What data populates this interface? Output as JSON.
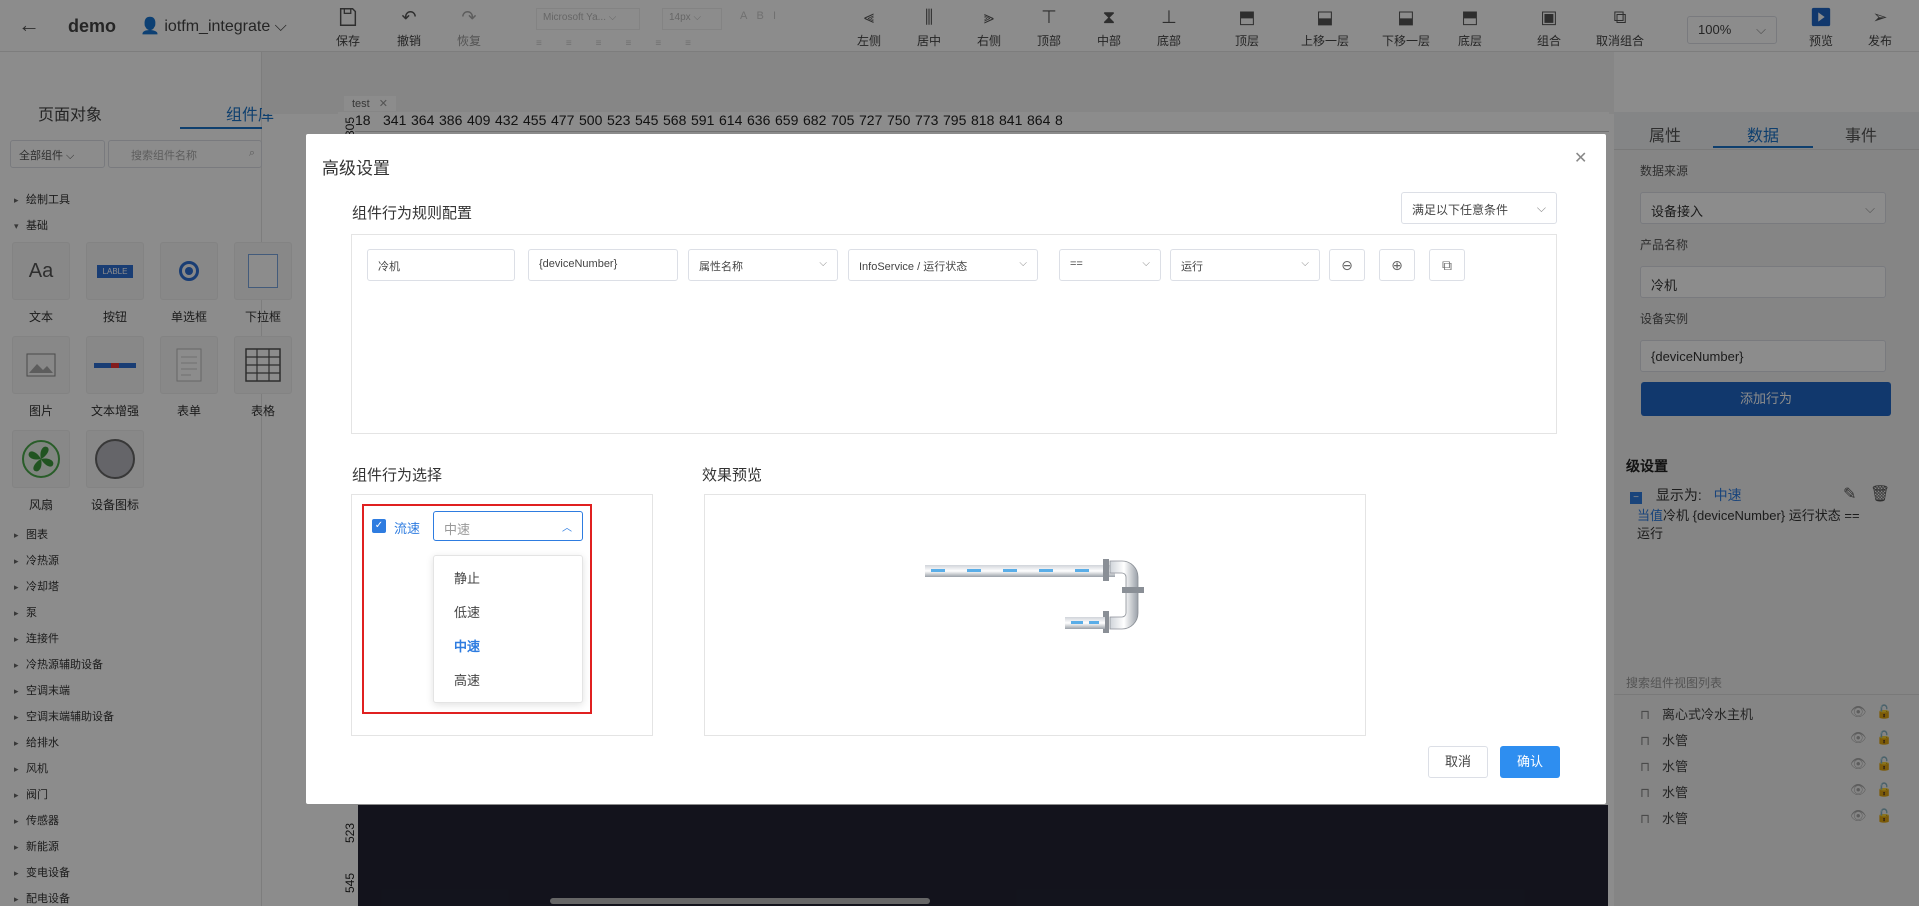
{
  "header": {
    "project": "demo",
    "user": "iotfm_integrate",
    "tools": [
      {
        "label": "保存",
        "icon": "save-icon"
      },
      {
        "label": "撤销",
        "icon": "undo-icon"
      },
      {
        "label": "恢复",
        "icon": "redo-icon"
      }
    ],
    "font_family": "Microsoft Ya...",
    "font_size": "14px",
    "align_tools": [
      {
        "label": "左侧"
      },
      {
        "label": "居中"
      },
      {
        "label": "右侧"
      },
      {
        "label": "顶部"
      },
      {
        "label": "中部"
      },
      {
        "label": "底部"
      }
    ],
    "layer_tools": [
      {
        "label": "顶层"
      },
      {
        "label": "上移一层"
      },
      {
        "label": "下移一层"
      },
      {
        "label": "底层"
      }
    ],
    "group_tools": [
      {
        "label": "组合"
      },
      {
        "label": "取消组合"
      }
    ],
    "zoom": "100%",
    "preview": "预览",
    "publish": "发布"
  },
  "left": {
    "tabs": [
      "页面对象",
      "组件库"
    ],
    "filter": "全部组件",
    "search_placeholder": "搜索组件名称",
    "tree_top": [
      "绘制工具",
      "基础"
    ],
    "components": [
      {
        "label": "文本"
      },
      {
        "label": "按钮"
      },
      {
        "label": "单选框"
      },
      {
        "label": "下拉框"
      },
      {
        "label": "图片"
      },
      {
        "label": "文本增强"
      },
      {
        "label": "表单"
      },
      {
        "label": "表格"
      },
      {
        "label": "风扇"
      },
      {
        "label": "设备图标"
      }
    ],
    "button_tile_text": "LABLE",
    "text_tile_text": "Aa",
    "tree_bottom": [
      "图表",
      "冷热源",
      "冷却塔",
      "泵",
      "连接件",
      "冷热源辅助设备",
      "空调末端",
      "空调末端辅助设备",
      "给排水",
      "风机",
      "阀门",
      "传感器",
      "新能源",
      "变电设备",
      "配电设备"
    ]
  },
  "canvas": {
    "tab": "test",
    "ruler": [
      "18",
      "341",
      "364",
      "386",
      "409",
      "432",
      "455",
      "477",
      "500",
      "523",
      "545",
      "568",
      "591",
      "614",
      "636",
      "659",
      "682",
      "705",
      "727",
      "750",
      "773",
      "795",
      "818",
      "841",
      "864",
      "8"
    ],
    "ruler_start": "305",
    "vruler": [
      "523",
      "545"
    ]
  },
  "right": {
    "tabs": [
      "属性",
      "数据",
      "事件"
    ],
    "data_source_label": "数据来源",
    "data_source": "设备接入",
    "product_label": "产品名称",
    "product": "冷机",
    "instance_label": "设备实例",
    "instance": "{deviceNumber}",
    "add_behavior": "添加行为",
    "adv_title": "级设置",
    "display_as": "显示为:",
    "display_value": "中速",
    "when": "当值",
    "rule_text": "冷机 {deviceNumber} 运行状态 ==",
    "rule_value": "运行",
    "layer_search": "搜索组件视图列表",
    "layers": [
      "离心式冷水主机",
      "水管",
      "水管",
      "水管",
      "水管"
    ]
  },
  "dialog": {
    "title": "高级设置",
    "rules_title": "组件行为规则配置",
    "condition": "满足以下任意条件",
    "rule": {
      "product": "冷机",
      "instance": "{deviceNumber}",
      "attr_type": "属性名称",
      "attr": "InfoService / 运行状态",
      "op": "==",
      "value": "运行"
    },
    "behavior_title": "组件行为选择",
    "behavior_check": "流速",
    "speed_selected": "中速",
    "speed_options": [
      "静止",
      "低速",
      "中速",
      "高速"
    ],
    "preview_title": "效果预览",
    "cancel": "取消",
    "ok": "确认"
  }
}
